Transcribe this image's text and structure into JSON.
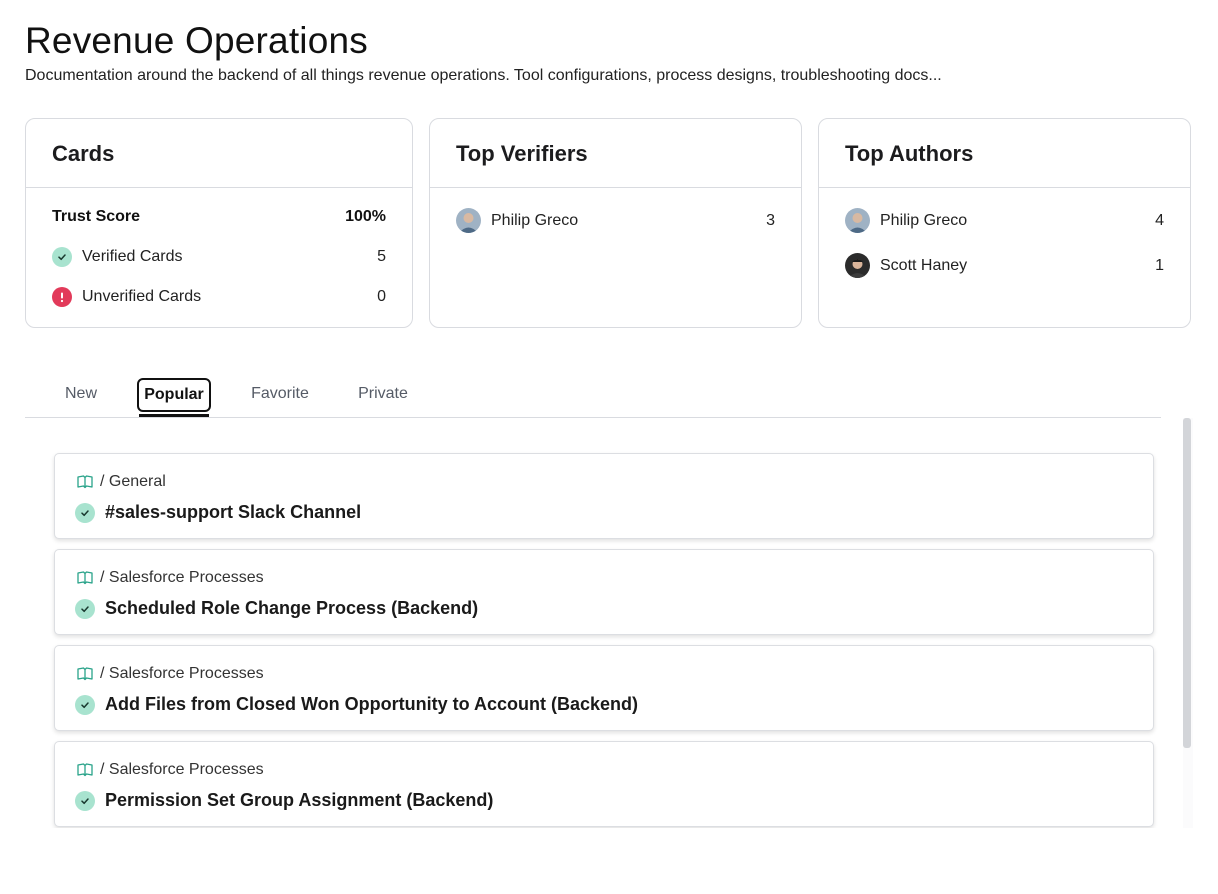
{
  "page": {
    "title": "Revenue Operations",
    "description": "Documentation around the backend of all things revenue operations. Tool configurations, process designs, troubleshooting docs..."
  },
  "cards_panel": {
    "heading": "Cards",
    "trust_label": "Trust Score",
    "trust_value": "100%",
    "verified_label": "Verified Cards",
    "verified_count": "5",
    "unverified_label": "Unverified Cards",
    "unverified_count": "0"
  },
  "verifiers_panel": {
    "heading": "Top Verifiers",
    "people": [
      {
        "name": "Philip Greco",
        "count": "3"
      }
    ]
  },
  "authors_panel": {
    "heading": "Top Authors",
    "people": [
      {
        "name": "Philip Greco",
        "count": "4"
      },
      {
        "name": "Scott Haney",
        "count": "1"
      }
    ]
  },
  "tabs": [
    {
      "label": "New",
      "active": false
    },
    {
      "label": "Popular",
      "active": true
    },
    {
      "label": "Favorite",
      "active": false
    },
    {
      "label": "Private",
      "active": false
    }
  ],
  "items": [
    {
      "collection": "/ General",
      "title": "#sales-support Slack Channel",
      "verified": true
    },
    {
      "collection": "/ Salesforce Processes",
      "title": "Scheduled Role Change Process (Backend)",
      "verified": true
    },
    {
      "collection": "/ Salesforce Processes",
      "title": "Add Files from Closed Won Opportunity to Account (Backend)",
      "verified": true
    },
    {
      "collection": "/ Salesforce Processes",
      "title": "Permission Set Group Assignment (Backend)",
      "verified": true
    }
  ],
  "colors": {
    "verified": "#a8e3cf",
    "unverified": "#e23a5a",
    "book_icon": "#2aa38a"
  },
  "icons": [
    "check-icon",
    "alert-icon",
    "book-icon",
    "avatar"
  ]
}
